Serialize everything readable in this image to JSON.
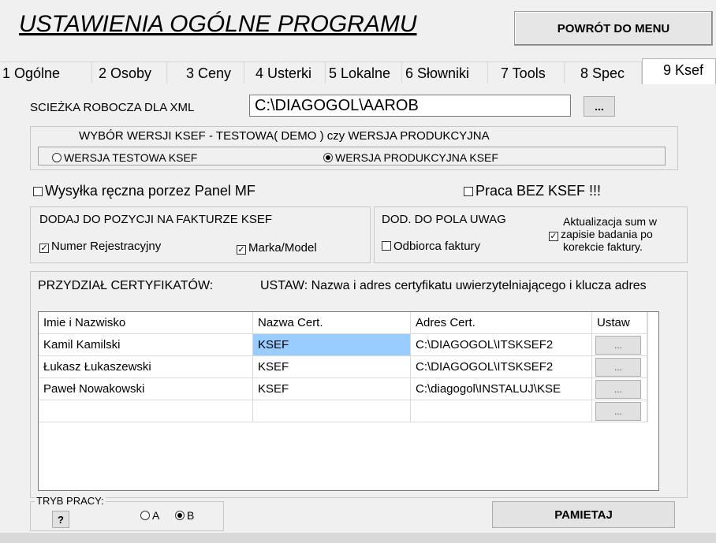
{
  "header": {
    "title": "USTAWIENIA OGÓLNE PROGRAMU",
    "menu_button": "POWRÓT DO MENU"
  },
  "tabs": [
    {
      "label": "1 Ogólne"
    },
    {
      "label": "2 Osoby"
    },
    {
      "label": "3 Ceny"
    },
    {
      "label": "4 Usterki"
    },
    {
      "label": "5 Lokalne"
    },
    {
      "label": "6 Słowniki"
    },
    {
      "label": "7 Tools"
    },
    {
      "label": "8 Spec"
    },
    {
      "label": "9 Ksef",
      "active": true
    }
  ],
  "xml_path": {
    "label": "SCIEŻKA ROBOCZA DLA XML",
    "value": "C:\\DIAGOGOL\\AAROB",
    "browse_button": "..."
  },
  "version_group": {
    "title": "WYBÓR WERSJI KSEF - TESTOWA( DEMO ) czy WERSJA PRODUKCYJNA",
    "option_test": "WERSJA TESTOWA KSEF",
    "option_prod": "WERSJA PRODUKCYJNA KSEF",
    "selected": "prod"
  },
  "manual_send": {
    "label": "Wysyłka ręczna porzez Panel MF",
    "checked": false
  },
  "no_ksef": {
    "label": "Praca  BEZ  KSEF   !!!",
    "checked": false
  },
  "add_to_invoice": {
    "title": "DODAJ DO POZYCJI NA FAKTURZE KSEF",
    "reg_number": {
      "label": "Numer Rejestracyjny",
      "checked": true
    },
    "brand_model": {
      "label": "Marka/Model",
      "checked": true
    }
  },
  "notes_field": {
    "title": "DOD. DO POLA UWAG",
    "recipient": {
      "label": "Odbiorca faktury",
      "checked": false
    },
    "update_sums_line1": "Aktualizacja sum w",
    "update_sums_line2": "zapisie badania po",
    "update_sums_line3": "korekcie faktury.",
    "update_sums_checked": true
  },
  "certificates": {
    "label": "PRZYDZIAŁ CERTYFIKATÓW:",
    "hint": "USTAW: Nazwa i adres certyfikatu uwierzytelniającego i klucza adres",
    "columns": [
      "Imie i Nazwisko",
      "Nazwa Cert.",
      "Adres Cert.",
      "Ustaw"
    ],
    "rows": [
      {
        "name": "Kamil Kamilski",
        "cert": "KSEF",
        "address": "C:\\DIAGOGOL\\ITSKSEF2",
        "btn": "...",
        "selected": true
      },
      {
        "name": "Łukasz Łukaszewski",
        "cert": "KSEF",
        "address": "C:\\DIAGOGOL\\ITSKSEF2",
        "btn": "..."
      },
      {
        "name": "Paweł Nowakowski",
        "cert": "KSEF",
        "address": "C:\\diagogol\\INSTALUJ\\KSE",
        "btn": "..."
      },
      {
        "name": "",
        "cert": "",
        "address": "",
        "btn": "..."
      }
    ]
  },
  "work_mode": {
    "label": "TRYB PRACY:",
    "help_button": "?",
    "option_a": "A",
    "option_b": "B",
    "selected": "B"
  },
  "save_button": "PAMIETAJ",
  "colors": {
    "selected_cell": "#99ccff",
    "background": "#f0f0f0"
  }
}
